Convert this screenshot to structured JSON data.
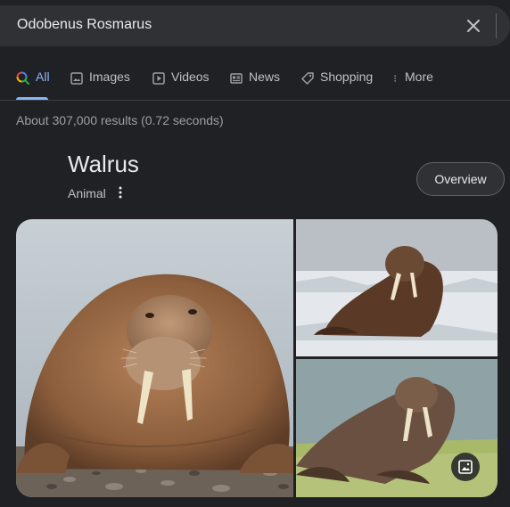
{
  "search": {
    "query": "Odobenus Rosmarus"
  },
  "tabs": [
    {
      "label": "All",
      "icon": "search-icon",
      "active": true
    },
    {
      "label": "Images",
      "icon": "image-icon"
    },
    {
      "label": "Videos",
      "icon": "video-icon"
    },
    {
      "label": "News",
      "icon": "news-icon"
    },
    {
      "label": "Shopping",
      "icon": "tag-icon"
    },
    {
      "label": "More",
      "icon": "more-vert-icon"
    }
  ],
  "result_stats": "About 307,000 results (0.72 seconds)",
  "knowledge_panel": {
    "title": "Walrus",
    "subtitle": "Animal",
    "overview_label": "Overview"
  },
  "colors": {
    "background": "#202124",
    "accent": "#8ab4f8",
    "search_bar": "#303134"
  }
}
